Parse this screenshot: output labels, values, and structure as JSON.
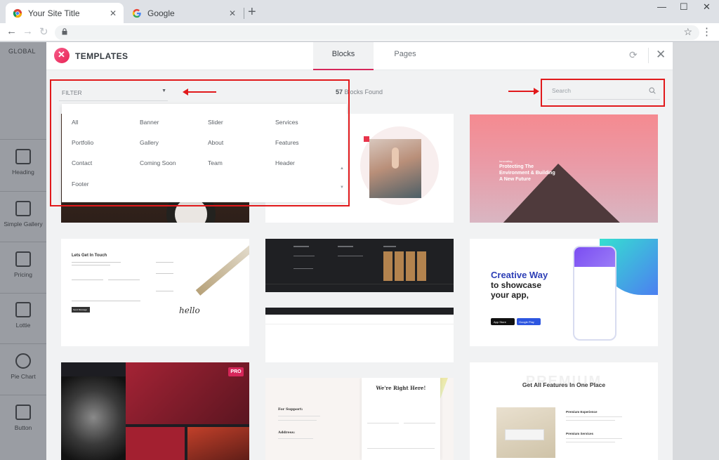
{
  "browser": {
    "tabs": [
      {
        "title": "Your Site Title",
        "close": "✕",
        "favicon": "chrome-icon"
      },
      {
        "title": "Google",
        "close": "✕",
        "favicon": "google-icon"
      }
    ],
    "new_tab": "+",
    "window_controls": {
      "minimize": "—",
      "maximize": "☐",
      "close": "✕"
    },
    "nav": {
      "back": "←",
      "forward": "→",
      "reload": "↻"
    },
    "bookmark_star": "☆",
    "menu": "⋮"
  },
  "editor_sidebar": {
    "section_label": "GLOBAL",
    "widgets": [
      {
        "label": "Heading",
        "icon": "heading-icon"
      },
      {
        "label": "Simple Gallery",
        "icon": "gallery-icon"
      },
      {
        "label": "Pricing",
        "icon": "pricing-icon"
      },
      {
        "label": "Lottie",
        "icon": "lottie-icon"
      },
      {
        "label": "Pie Chart",
        "icon": "pie-chart-icon"
      },
      {
        "label": "Button",
        "icon": "button-icon"
      }
    ]
  },
  "modal": {
    "title": "TEMPLATES",
    "logo_glyph": "✕",
    "tabs": [
      {
        "label": "Blocks",
        "active": true
      },
      {
        "label": "Pages",
        "active": false
      }
    ],
    "sync_glyph": "⟳",
    "close_glyph": "✕",
    "filter": {
      "label": "FILTER",
      "caret": "▼",
      "options": [
        "All",
        "Banner",
        "Slider",
        "Services",
        "Portfolio",
        "Gallery",
        "About",
        "Features",
        "Contact",
        "Coming Soon",
        "Team",
        "Header",
        "Footer"
      ]
    },
    "count": {
      "number": "57",
      "suffix": "Blocks Found"
    },
    "search": {
      "placeholder": "Search",
      "value": ""
    },
    "cards": {
      "mountain": {
        "heading": "Protecting The Environment & Building A New Future",
        "kicker": "Innovating"
      },
      "contact": {
        "heading": "Lets Get In Touch",
        "button": "Send Message",
        "signature": "hello"
      },
      "app": {
        "line1": "Creative Way",
        "line2": "to showcase",
        "line3": "your app,",
        "store1": "App Store",
        "store2": "Google Play"
      },
      "pro_badge": "PRO",
      "support": {
        "left_title": "For Support:",
        "address_title": "Address:",
        "form_title": "We're Right Here!"
      },
      "premium": {
        "ghost": "PREMIUM",
        "heading": "Get All Features In One Place",
        "f1": "Premium Experience",
        "f2": "Premium Services"
      }
    }
  },
  "colors": {
    "accent": "#d6275a",
    "annotation": "#e1191b"
  }
}
